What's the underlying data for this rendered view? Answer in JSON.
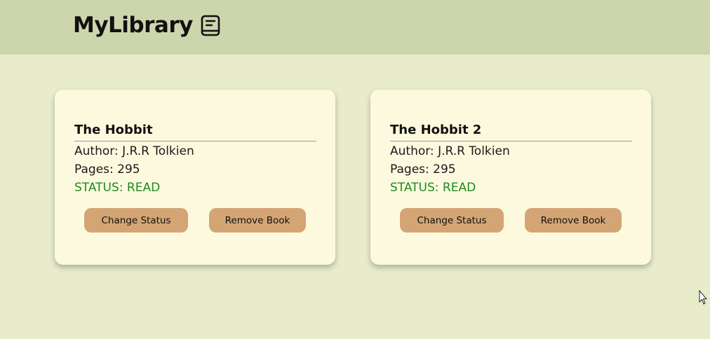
{
  "header": {
    "title": "MyLibrary",
    "icon": "book-icon"
  },
  "books": [
    {
      "title": "The Hobbit",
      "author": "Author: J.R.R Tolkien",
      "pages": "Pages: 295",
      "status": "STATUS: READ",
      "change_status_label": "Change Status",
      "remove_label": "Remove Book"
    },
    {
      "title": "The Hobbit 2",
      "author": "Author: J.R.R Tolkien",
      "pages": "Pages: 295",
      "status": "STATUS: READ",
      "change_status_label": "Change Status",
      "remove_label": "Remove Book"
    }
  ],
  "colors": {
    "background": "#e8eccb",
    "header": "#cdd5ad",
    "card": "#fdf9df",
    "button": "#d4a574",
    "status_read": "#1e8a1e"
  }
}
